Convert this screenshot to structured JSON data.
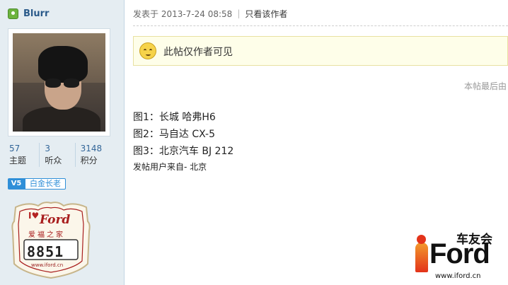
{
  "user": {
    "name": "Blurr",
    "stats": [
      {
        "value": "57",
        "label": "主题"
      },
      {
        "value": "3",
        "label": "听众"
      },
      {
        "value": "3148",
        "label": "积分"
      }
    ],
    "level_icon": "V5",
    "level_title": "白金长老",
    "badge": {
      "brand": "Ford",
      "subtitle": "爱福之家",
      "number": "8851",
      "url": "www.iford.cn"
    }
  },
  "post": {
    "posted_at": "发表于 2013-7-24 08:58",
    "view_author_only": "只看该作者",
    "notice": "此帖仅作者可见",
    "last_edit": "本帖最后由",
    "lines": [
      "图1：长城 哈弗H6",
      "图2：马自达 CX-5",
      "图3：北京汽车 BJ 212"
    ],
    "from": "发帖用户来自- 北京"
  },
  "watermark": {
    "top_text": "车友会",
    "brand": "Ford",
    "url": "www.iford.cn"
  },
  "icons": {
    "user_online": "user-online-icon",
    "notice": "smiley-icon"
  },
  "colors": {
    "sidebar_bg": "#e5edf2",
    "link": "#336699",
    "notice_bg": "#fefee9",
    "level_blue": "#2f8fd8",
    "brand_red": "#e3331a"
  }
}
